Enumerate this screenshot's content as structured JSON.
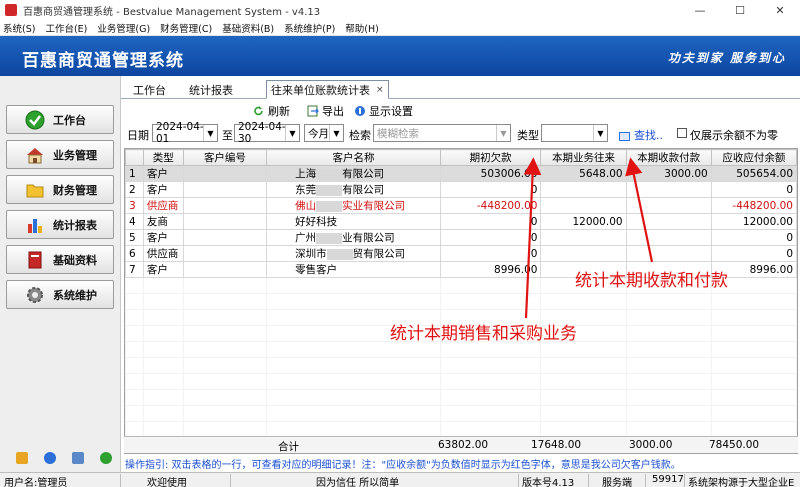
{
  "window": {
    "title": "百惠商贸通管理系统 - Bestvalue Management System - v4.13",
    "minimize": "—",
    "maximize": "☐",
    "close": "✕"
  },
  "menu": [
    "系统(S)",
    "工作台(E)",
    "业务管理(G)",
    "财务管理(C)",
    "基础资料(B)",
    "系统维护(P)",
    "帮助(H)"
  ],
  "banner": {
    "brand": "百惠商贸通管理系统",
    "slogan": "功夫到家 服务到心"
  },
  "sidebar": {
    "items": [
      {
        "label": "工作台",
        "icon": "check-circle-icon"
      },
      {
        "label": "业务管理",
        "icon": "house-icon"
      },
      {
        "label": "财务管理",
        "icon": "folder-icon"
      },
      {
        "label": "统计报表",
        "icon": "bar-chart-icon"
      },
      {
        "label": "基础资料",
        "icon": "book-icon"
      },
      {
        "label": "系统维护",
        "icon": "gear-icon"
      }
    ]
  },
  "tabs": [
    {
      "label": "工作台"
    },
    {
      "label": "统计报表"
    },
    {
      "label": "往来单位账款统计表",
      "close": "×"
    }
  ],
  "toolbar": {
    "refresh": "刷新",
    "export": "导出",
    "display_settings": "显示设置"
  },
  "filter": {
    "date_label": "日期",
    "date_from": "2024-04-01",
    "to_label": "至",
    "date_to": "2024-04-30",
    "period": "今月",
    "search_label": "检索",
    "search_placeholder": "模糊检索",
    "type_label": "类型",
    "type_value": "",
    "find_button": "查找..",
    "nonzero_only": "仅展示余额不为零"
  },
  "grid": {
    "columns": [
      "",
      "类型",
      "客户编号",
      "客户名称",
      "期初欠款",
      "本期业务往来",
      "本期收款付款",
      "应收应付余额"
    ],
    "rows": [
      {
        "no": "1",
        "type": "客户",
        "code": "",
        "name_a": "上海",
        "name_b": "有限公司",
        "opening": "503006.00",
        "business": "5648.00",
        "receipt": "3000.00",
        "balance": "505654.00",
        "red": false
      },
      {
        "no": "2",
        "type": "客户",
        "code": "",
        "name_a": "东莞",
        "name_b": "有限公司",
        "opening": "0",
        "business": "",
        "receipt": "",
        "balance": "0",
        "red": false
      },
      {
        "no": "3",
        "type": "供应商",
        "code": "",
        "name_a": "佛山",
        "name_b": "实业有限公司",
        "opening": "-448200.00",
        "business": "",
        "receipt": "",
        "balance": "-448200.00",
        "red": true
      },
      {
        "no": "4",
        "type": "友商",
        "code": "",
        "name_a": "好好科技",
        "name_b": "",
        "opening": "0",
        "business": "12000.00",
        "receipt": "",
        "balance": "12000.00",
        "red": false
      },
      {
        "no": "5",
        "type": "客户",
        "code": "",
        "name_a": "广州",
        "name_b": "业有限公司",
        "opening": "0",
        "business": "",
        "receipt": "",
        "balance": "0",
        "red": false
      },
      {
        "no": "6",
        "type": "供应商",
        "code": "",
        "name_a": "深圳市",
        "name_b": "贸有限公司",
        "opening": "0",
        "business": "",
        "receipt": "",
        "balance": "0",
        "red": false
      },
      {
        "no": "7",
        "type": "客户",
        "code": "",
        "name_a": "零售客户",
        "name_b": "",
        "opening": "8996.00",
        "business": "",
        "receipt": "",
        "balance": "8996.00",
        "red": false
      }
    ],
    "totals": {
      "label": "合计",
      "opening": "63802.00",
      "business": "17648.00",
      "receipt": "3000.00",
      "balance": "78450.00"
    }
  },
  "hint": "操作指引: 双击表格的一行，可查看对应的明细记录！注：\"应收余额\"为负数值时显示为红色字体，意思是我公司欠客户钱款。",
  "annotations": {
    "receipts": "统计本期收款和付款",
    "business": "统计本期销售和采购业务"
  },
  "status": {
    "user": "用户名:管理员",
    "welcome": "欢迎使用",
    "motto": "因为信任 所以简单",
    "version": "版本号4.13",
    "server_label": "服务端",
    "server_port": "59917",
    "arch": "系统架构源于大型企业E"
  },
  "colors": {
    "banner": "#1e65c2",
    "accent_red": "#e01212",
    "hint_blue": "#1a4fd0"
  }
}
